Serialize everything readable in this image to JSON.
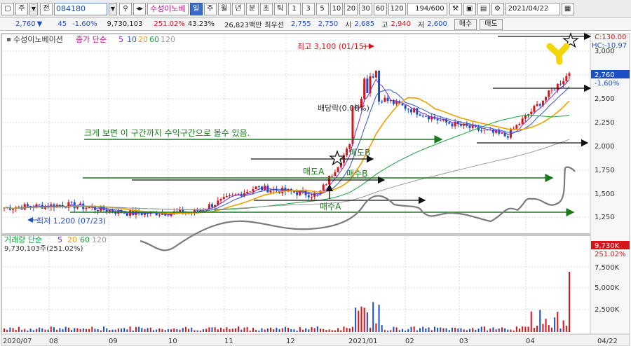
{
  "toolbar": {
    "mode_label": "주",
    "prev_label": "전",
    "stock_code": "084180",
    "stock_name": "수성이노베",
    "period_tabs": [
      "일",
      "주",
      "월",
      "년",
      "분",
      "초",
      "틱"
    ],
    "selected_period": "일",
    "number_tabs": [
      "1",
      "3",
      "5",
      "10",
      "20",
      "30",
      "60",
      "120"
    ],
    "count": "194/600",
    "date": "2021/04/22"
  },
  "quote": {
    "price": "2,760",
    "change": "45",
    "change_rate": "-1.60%",
    "volume": "9,730,103",
    "volume_rate": "251.02%",
    "turnover": "43.23%",
    "amount": "26,823백만",
    "best_label": "최우선",
    "best_ask": "2,755",
    "best_bid": "2,750",
    "open_label": "시",
    "open": "2,685",
    "high_label": "고",
    "high": "2,940",
    "low_label": "저",
    "low": "2,600",
    "buy_label": "매수",
    "sell_label": "매도"
  },
  "price_pane": {
    "legend_name": "수성이노베이션",
    "ma_label": "종가 단순",
    "ma_periods": [
      "5",
      "10",
      "20",
      "60",
      "120"
    ],
    "ma_colors": [
      "#7a2bd6",
      "#2f55d6",
      "#f0a000",
      "#17a03a",
      "#9a9a9a"
    ],
    "axis_ticks": [
      "3,000",
      "2,750",
      "2,500",
      "2,250",
      "2,000",
      "1,750",
      "1,500",
      "1,250"
    ],
    "axis_top_c": "C:130.00",
    "axis_top_hc": "HC:-10.97",
    "last_price": "2,760",
    "last_change": "-1.60%",
    "high_note": "최고 3,100 (01/15)",
    "low_note": "최저 1,200 (07/23)",
    "dividend_note": "배당락(0.00%)"
  },
  "volume_pane": {
    "legend_label": "거래량 단순",
    "ma_periods": [
      "5",
      "20",
      "60",
      "120"
    ],
    "volume_text": "9,730,103주(251.02%)",
    "axis_ticks": [
      "7,500K",
      "5,000K",
      "2,500K"
    ],
    "last_volume": "9,730K",
    "last_rate": "251.02%"
  },
  "x_axis": [
    "2020/07",
    "08",
    "09",
    "10",
    "11",
    "12",
    "2021/01",
    "02",
    "03",
    "04",
    "04/22"
  ],
  "annotations": {
    "main_text": "크게 보면 이 구간까지 수익구간으로 볼수 있음.",
    "labels": [
      "매도A",
      "매도B",
      "매수A",
      "매수B"
    ]
  },
  "chart_data": {
    "type": "candlestick",
    "x": [
      "2020/07",
      "08",
      "09",
      "10",
      "11",
      "12",
      "2021/01",
      "02",
      "03",
      "04"
    ],
    "close_approx": [
      1350,
      1380,
      1290,
      1300,
      1560,
      1480,
      2500,
      2250,
      2100,
      2760
    ],
    "high_points": [
      {
        "label": "최고",
        "date": "01/15",
        "value": 3100
      },
      {
        "label": "최저",
        "date": "07/23",
        "value": 1200
      }
    ],
    "y_range": [
      1200,
      3150
    ]
  }
}
